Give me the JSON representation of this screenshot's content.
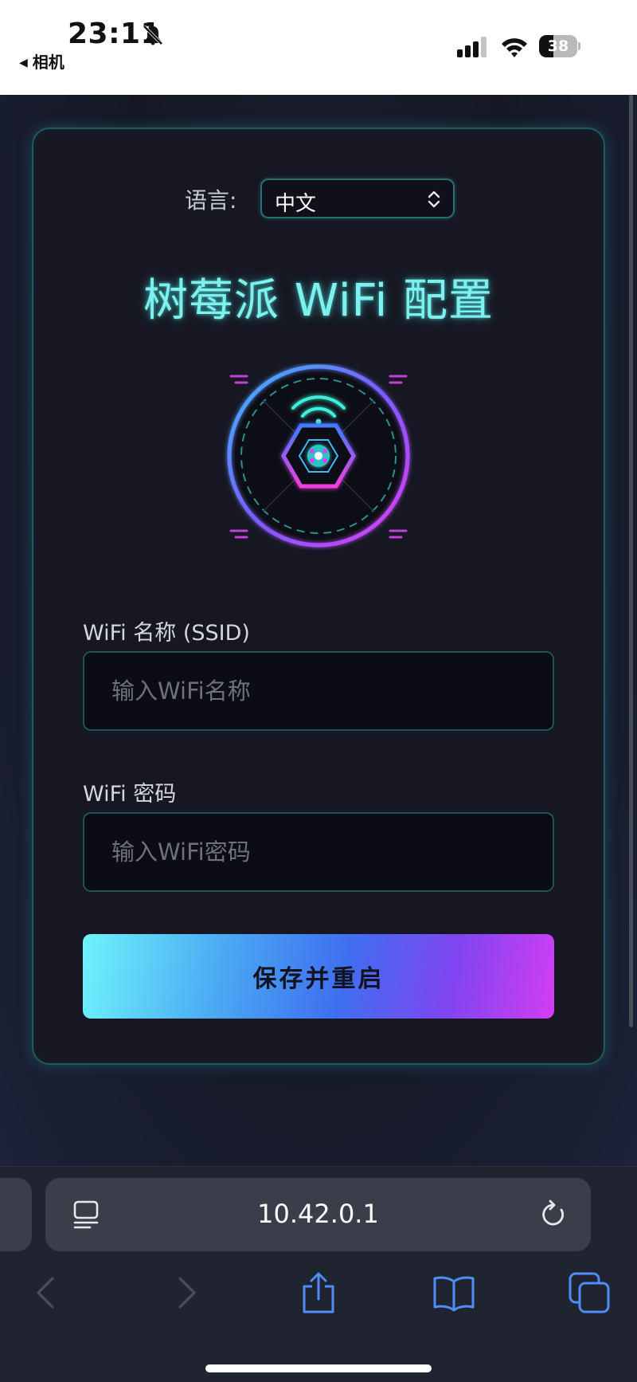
{
  "status_bar": {
    "time": "23:11",
    "back_app": "相机",
    "battery_level": "38",
    "battery_fraction": 0.38,
    "icons": [
      "bell-slash-icon",
      "cellular-signal-icon",
      "wifi-icon",
      "battery-icon"
    ]
  },
  "form": {
    "language_label": "语言:",
    "language_value": "中文",
    "title": "树莓派 WiFi 配置",
    "ssid_label": "WiFi 名称 (SSID)",
    "ssid_placeholder": "输入WiFi名称",
    "ssid_value": "",
    "password_label": "WiFi 密码",
    "password_placeholder": "输入WiFi密码",
    "password_value": "",
    "submit_label": "保存并重启",
    "colors": {
      "accent_cyan": "#7ef1ee",
      "accent_magenta": "#d23ef2",
      "accent_blue": "#3f6ff0"
    }
  },
  "browser": {
    "url": "10.42.0.1",
    "icons": [
      "reader-icon",
      "reload-icon",
      "back-arrow-icon",
      "forward-arrow-icon",
      "share-icon",
      "bookmarks-icon",
      "tabs-icon"
    ]
  }
}
